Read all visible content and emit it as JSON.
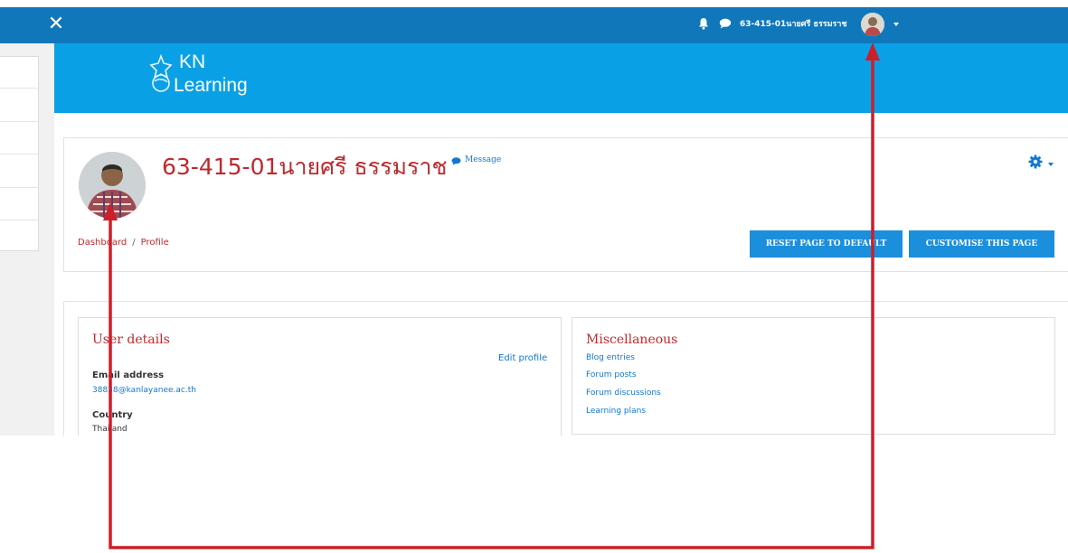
{
  "topbar": {
    "close_icon": "close-icon",
    "user_name": "63-415-01นายศรี ธรรมราช",
    "colors": {
      "bar": "#1177bb"
    }
  },
  "banner": {
    "logo_line1": "KN",
    "logo_line2": "Learning",
    "color": "#0aa0e6"
  },
  "header": {
    "title": "63-415-01นายศรี ธรรมราช",
    "message_label": "Message",
    "breadcrumb": [
      "Dashboard",
      "Profile"
    ],
    "buttons": {
      "reset": "RESET PAGE TO DEFAULT",
      "customise": "CUSTOMISE THIS PAGE"
    },
    "accent": "#c0282d"
  },
  "user_details": {
    "title": "User details",
    "edit_label": "Edit profile",
    "email_label": "Email address",
    "email_value": "38838@kanlayanee.ac.th",
    "country_label": "Country",
    "country_value": "Thailand"
  },
  "misc": {
    "title": "Miscellaneous",
    "links": [
      "Blog entries",
      "Forum posts",
      "Forum discussions",
      "Learning plans"
    ]
  },
  "annotation": {
    "arrow_color": "#cc1f2a"
  }
}
